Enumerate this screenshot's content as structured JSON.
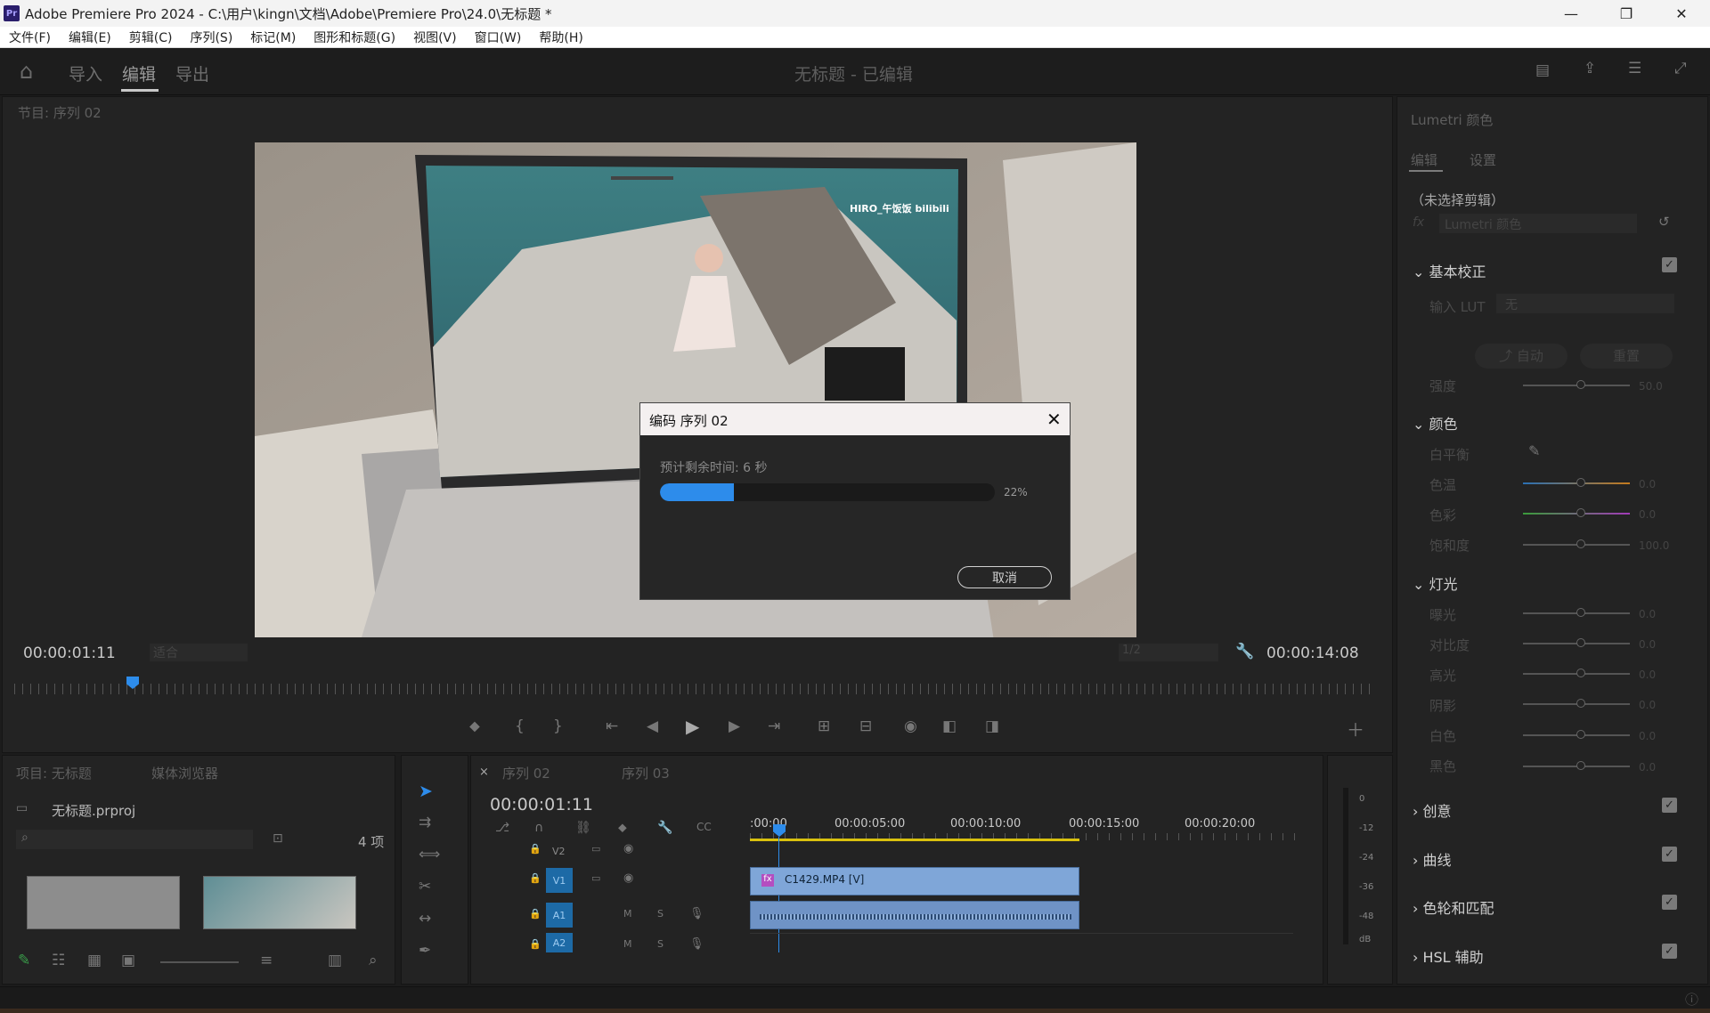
{
  "window": {
    "title": "Adobe Premiere Pro 2024 - C:\\用户\\kingn\\文档\\Adobe\\Premiere Pro\\24.0\\无标题 *",
    "logo": "Pr",
    "minimize": "—",
    "restore": "❐",
    "close": "✕"
  },
  "menu": [
    "文件(F)",
    "编辑(E)",
    "剪辑(C)",
    "序列(S)",
    "标记(M)",
    "图形和标题(G)",
    "视图(V)",
    "窗口(W)",
    "帮助(H)"
  ],
  "header": {
    "tabs": [
      "导入",
      "编辑",
      "导出"
    ],
    "active_tab": "编辑",
    "project_title": "无标题 - 已编辑"
  },
  "program_monitor": {
    "title": "节目: 序列 02",
    "current_time": "00:00:01:11",
    "fit_label": "适合",
    "resolution": "1/2",
    "duration": "00:00:14:08",
    "overlay_text": "HIRO_午饭饭  bilibili"
  },
  "dialog": {
    "title": "编码 序列 02",
    "remaining": "预计剩余时间: 6 秒",
    "percent": "22%",
    "progress": 0.22,
    "cancel": "取消"
  },
  "project_panel": {
    "tab_project": "项目: 无标题",
    "tab_media": "媒体浏览器",
    "file": "无标题.prproj",
    "count": "4 项"
  },
  "timeline": {
    "tab_active": "序列 02",
    "tab_other": "序列 03",
    "current_time": "00:00:01:11",
    "ruler": [
      ":00:00",
      "00:00:05:00",
      "00:00:10:00",
      "00:00:15:00",
      "00:00:20:00"
    ],
    "tracks": [
      "V2",
      "V1",
      "A1",
      "A2"
    ],
    "clip_name": "C1429.MP4 [V]",
    "clip_fx": "fx"
  },
  "audio_meter": [
    "0",
    "-12",
    "-24",
    "-36",
    "-48",
    "dB"
  ],
  "lumetri": {
    "title": "Lumetri 颜色",
    "tab_edit": "编辑",
    "tab_settings": "设置",
    "no_clip": "（未选择剪辑）",
    "fx_label": "fx",
    "effect_dropdown": "Lumetri 颜色",
    "basic": "基本校正",
    "lut_label": "输入 LUT",
    "lut_value": "无",
    "auto_btn": "自动",
    "reset_btn": "重置",
    "intensity": {
      "label": "强度",
      "value": "50.0"
    },
    "color_section": "颜色",
    "white_balance": "白平衡",
    "color_rows": [
      {
        "label": "色温",
        "value": "0.0"
      },
      {
        "label": "色彩",
        "value": "0.0"
      },
      {
        "label": "饱和度",
        "value": "100.0"
      }
    ],
    "light_section": "灯光",
    "light_rows": [
      {
        "label": "曝光",
        "value": "0.0"
      },
      {
        "label": "对比度",
        "value": "0.0"
      },
      {
        "label": "高光",
        "value": "0.0"
      },
      {
        "label": "阴影",
        "value": "0.0"
      },
      {
        "label": "白色",
        "value": "0.0"
      },
      {
        "label": "黑色",
        "value": "0.0"
      }
    ],
    "sections": [
      "创意",
      "曲线",
      "色轮和匹配",
      "HSL 辅助"
    ]
  },
  "colors": {
    "accent": "#2d8ceb",
    "clip_video": "#7fa6d8",
    "clip_audio": "#6f93c6",
    "work_area": "#d9c10e"
  }
}
